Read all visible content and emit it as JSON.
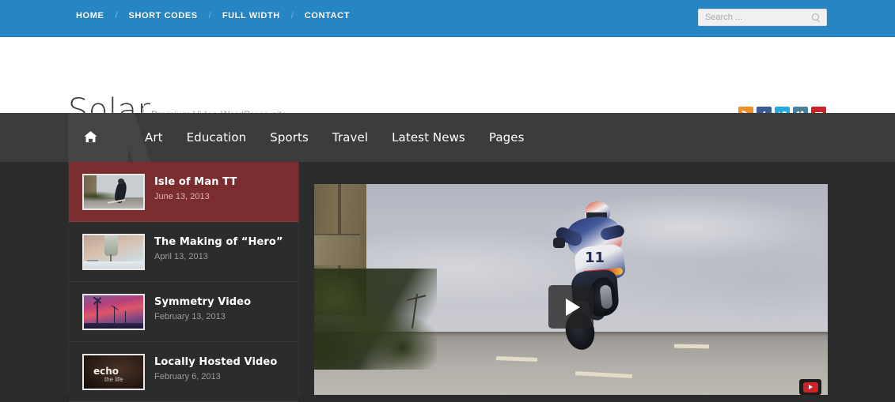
{
  "topbar": {
    "nav": [
      {
        "label": "HOME"
      },
      {
        "label": "SHORT CODES"
      },
      {
        "label": "FULL WIDTH"
      },
      {
        "label": "CONTACT"
      }
    ],
    "separator": "/",
    "search": {
      "placeholder": "Search ...",
      "value": "",
      "icon": "search-icon"
    },
    "bg_color": "#2785c4"
  },
  "header": {
    "logo": "Solar",
    "tagline": "Premium Video WordPress site",
    "socials": [
      {
        "name": "rss",
        "label": "RSS",
        "color": "#ef8f28"
      },
      {
        "name": "facebook",
        "label": "Facebook",
        "color": "#3a5a98"
      },
      {
        "name": "twitter",
        "label": "Twitter",
        "color": "#26a9e0"
      },
      {
        "name": "vimeo",
        "label": "Vimeo",
        "color": "#4a7f9e"
      },
      {
        "name": "youtube",
        "label": "YouTube",
        "color": "#cc2229"
      }
    ]
  },
  "mainnav": {
    "home_icon": "home-icon",
    "items": [
      {
        "label": "Art"
      },
      {
        "label": "Education"
      },
      {
        "label": "Sports"
      },
      {
        "label": "Travel"
      },
      {
        "label": "Latest News"
      },
      {
        "label": "Pages"
      }
    ],
    "bg_color": "#3b3b3b",
    "active_color": "#444444"
  },
  "playlist": {
    "items": [
      {
        "title": "Isle of Man TT",
        "date": "June 13, 2013",
        "active": true,
        "thumb": "motorcycle-jump"
      },
      {
        "title": "The Making of “Hero”",
        "date": "April 13, 2013",
        "active": false,
        "thumb": "needle-closeup"
      },
      {
        "title": "Symmetry Video",
        "date": "February 13, 2013",
        "active": false,
        "thumb": "wind-turbines-sunset"
      },
      {
        "title": "Locally Hosted Video",
        "date": "February 6, 2013",
        "active": false,
        "thumb": "echo-the-life"
      }
    ],
    "active_bg_color": "#7b2c2e"
  },
  "player": {
    "play_button_icon": "play-icon",
    "badge_icon": "youtube-logo-icon",
    "poster_description": "motorcycle-jump"
  },
  "thumb_echo": {
    "main": "echo",
    "sub": "the life"
  }
}
